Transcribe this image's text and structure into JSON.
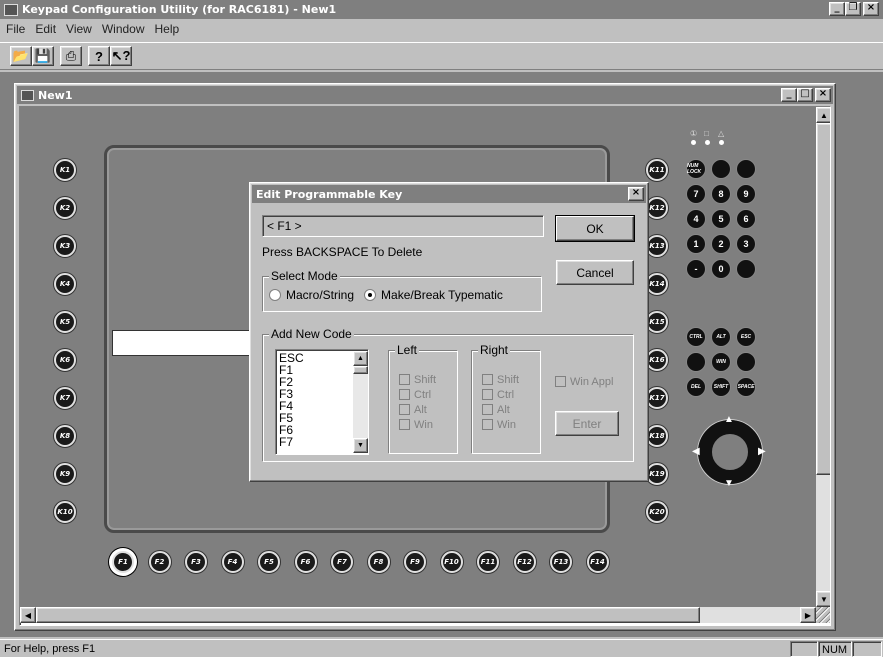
{
  "app": {
    "title": "Keypad Configuration Utility (for RAC6181) - New1"
  },
  "menu": [
    "File",
    "Edit",
    "View",
    "Window",
    "Help"
  ],
  "toolbar": {
    "icons": [
      "open-folder-icon",
      "save-icon",
      "print-icon",
      "help-icon",
      "context-help-icon"
    ]
  },
  "mdi": {
    "title": "New1"
  },
  "keypad": {
    "left_keys": [
      "K1",
      "K2",
      "K3",
      "K4",
      "K5",
      "K6",
      "K7",
      "K8",
      "K9",
      "K10"
    ],
    "right_keys": [
      "K11",
      "K12",
      "K13",
      "K14",
      "K15",
      "K16",
      "K17",
      "K18",
      "K19",
      "K20"
    ],
    "bottom_keys": [
      "F1",
      "F2",
      "F3",
      "F4",
      "F5",
      "F6",
      "F7",
      "F8",
      "F9",
      "F10",
      "F11",
      "F12",
      "F13",
      "F14"
    ],
    "numpad": [
      [
        "NUM LOCK",
        "",
        ""
      ],
      [
        "7",
        "8",
        "9"
      ],
      [
        "4",
        "5",
        "6"
      ],
      [
        "1",
        "2",
        "3"
      ],
      [
        "-",
        "0",
        ""
      ]
    ],
    "func_keys": [
      [
        "CTRL",
        "ALT",
        "ESC"
      ],
      [
        "",
        "WIN",
        ""
      ],
      [
        "DEL",
        "SHIFT",
        "SPACE"
      ]
    ],
    "indicator_symbols": [
      "①",
      "□",
      "△"
    ]
  },
  "dialog": {
    "title": "Edit Programmable Key",
    "key_value": "< F1 >",
    "hint": "Press BACKSPACE To Delete",
    "ok": "OK",
    "cancel": "Cancel",
    "select_mode": {
      "label": "Select Mode",
      "options": [
        "Macro/String",
        "Make/Break Typematic"
      ],
      "selected": "Make/Break Typematic"
    },
    "add_new_code": {
      "label": "Add New Code",
      "codes": [
        "ESC",
        "F1",
        "F2",
        "F3",
        "F4",
        "F5",
        "F6",
        "F7"
      ],
      "left": {
        "label": "Left",
        "options": [
          "Shift",
          "Ctrl",
          "Alt",
          "Win"
        ]
      },
      "right": {
        "label": "Right",
        "options": [
          "Shift",
          "Ctrl",
          "Alt",
          "Win"
        ]
      },
      "win_appl": "Win Appl",
      "enter": "Enter"
    }
  },
  "status": {
    "help": "For Help, press F1",
    "num": "NUM"
  }
}
